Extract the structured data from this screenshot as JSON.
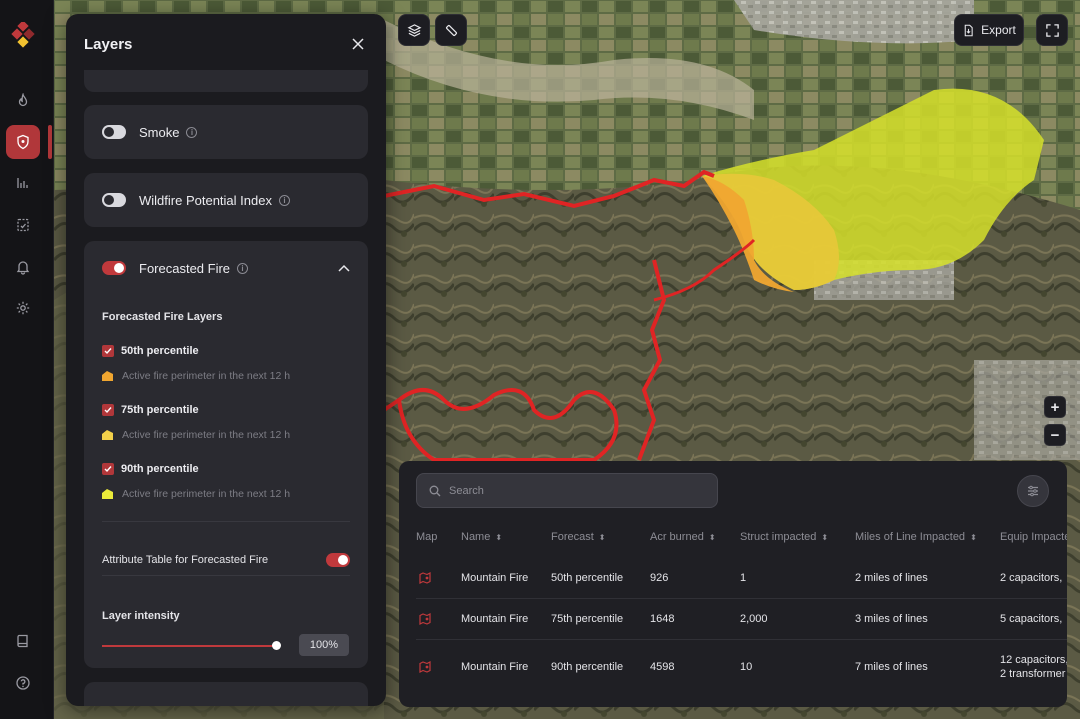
{
  "panel": {
    "title": "Layers",
    "layers": [
      {
        "label": "Smoke",
        "enabled": false
      },
      {
        "label": "Wildfire Potential Index",
        "enabled": false
      },
      {
        "label": "Forecasted Fire",
        "enabled": true
      }
    ],
    "forecast_section": {
      "title": "Forecasted Fire Layers",
      "items": [
        {
          "label": "50th percentile",
          "checked": true,
          "legend": "Active fire perimeter in the next 12 h",
          "color": "#f0a630"
        },
        {
          "label": "75th percentile",
          "checked": true,
          "legend": "Active fire perimeter in the next 12 h",
          "color": "#f2d04a"
        },
        {
          "label": "90th percentile",
          "checked": true,
          "legend": "Active fire perimeter in the next 12 h",
          "color": "#eaea3a"
        }
      ],
      "attribute_table_label": "Attribute Table for Forecasted Fire",
      "attribute_table_enabled": true,
      "intensity_label": "Layer intensity",
      "intensity_value": "100%",
      "intensity_fraction": 1.0
    }
  },
  "map_controls": {
    "export_label": "Export",
    "zoom_in": "+",
    "zoom_out": "−"
  },
  "table": {
    "search_placeholder": "Search",
    "columns": [
      "Map",
      "Name",
      "Forecast",
      "Acr burned",
      "Struct impacted",
      "Miles of Line Impacted",
      "Equip Impacte"
    ],
    "rows": [
      {
        "name": "Mountain Fire",
        "forecast": "50th percentile",
        "acr": "926",
        "struct": "1",
        "miles": "2 miles of lines",
        "equip": "2 capacitors,",
        "equip2": ""
      },
      {
        "name": "Mountain Fire",
        "forecast": "75th percentile",
        "acr": "1648",
        "struct": "2,000",
        "miles": "3 miles of lines",
        "equip": "5 capacitors,",
        "equip2": ""
      },
      {
        "name": "Mountain Fire",
        "forecast": "90th percentile",
        "acr": "4598",
        "struct": "10",
        "miles": "7 miles of lines",
        "equip": "12 capacitors,",
        "equip2": "2 transformer"
      }
    ]
  },
  "colors": {
    "accent": "#b1373a",
    "fire_perimeter": "#e02424",
    "forecast_50": "#f0a630",
    "forecast_75": "#e8c83a",
    "forecast_90": "#d6e02a"
  }
}
